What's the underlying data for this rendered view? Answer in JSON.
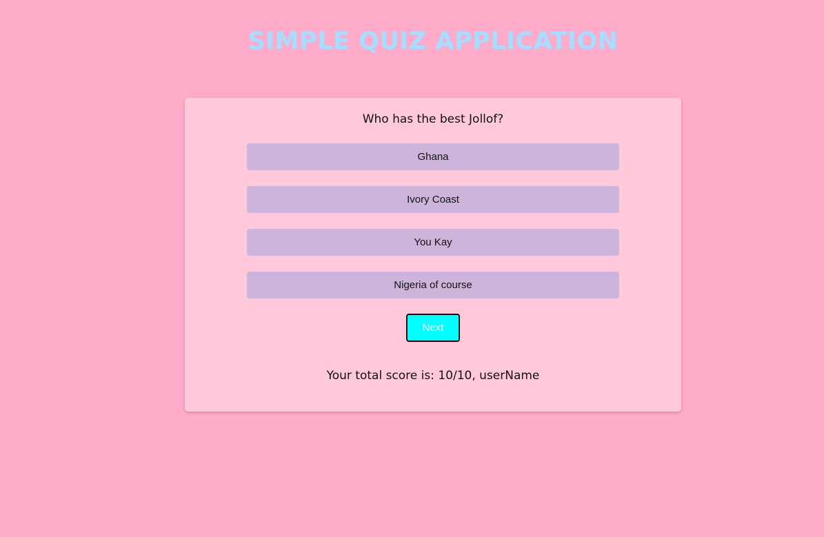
{
  "app": {
    "title": "SIMPLE QUIZ APPLICATION"
  },
  "quiz": {
    "question": "Who has the best Jollof?",
    "options": [
      {
        "label": "Ghana"
      },
      {
        "label": "Ivory Coast"
      },
      {
        "label": "You Kay"
      },
      {
        "label": "Nigeria of course"
      }
    ],
    "next_label": "Next",
    "score_text": "Your total score is: 10/10, userName"
  },
  "colors": {
    "background": "#ffabc9",
    "card": "#ffc8db",
    "option": "#cdb4da",
    "next_button": "#00ffff",
    "title": "#a9dcff"
  }
}
